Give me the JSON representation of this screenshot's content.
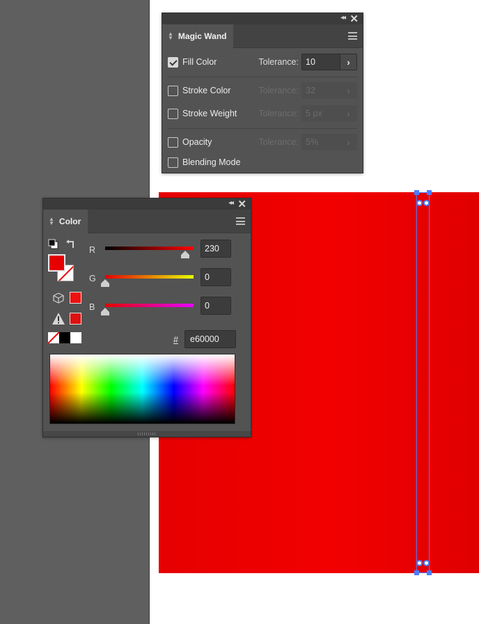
{
  "magic_wand": {
    "title": "Magic Wand",
    "rows": [
      {
        "label": "Fill Color",
        "checked": true,
        "tolerance_label": "Tolerance:",
        "tolerance": "10",
        "enabled": true
      },
      {
        "label": "Stroke Color",
        "checked": false,
        "tolerance_label": "Tolerance:",
        "tolerance": "32",
        "enabled": false
      },
      {
        "label": "Stroke Weight",
        "checked": false,
        "tolerance_label": "Tolerance:",
        "tolerance": "5 px",
        "enabled": false
      },
      {
        "label": "Opacity",
        "checked": false,
        "tolerance_label": "Tolerance:",
        "tolerance": "5%",
        "enabled": false
      },
      {
        "label": "Blending Mode",
        "checked": false
      }
    ]
  },
  "color_panel": {
    "title": "Color",
    "fill_color": "#e60000",
    "r_label": "R",
    "g_label": "G",
    "b_label": "B",
    "r_value": "230",
    "g_value": "0",
    "b_value": "0",
    "r_fraction": 0.902,
    "g_fraction": 0,
    "b_fraction": 0,
    "hex_symbol": "#",
    "hex_value": "e60000",
    "web_safe_color": "#ee1111",
    "gamut_color": "#dd1111"
  },
  "icons": {
    "panel_collapse": "double-left-chevron",
    "panel_close": "close-x",
    "panel_menu": "hamburger-menu",
    "tab_arrows": "up-down-arrows",
    "swap": "swap-arrow",
    "default_colors": "default-fill-stroke",
    "cube": "out-of-web-gamut-cube",
    "warning": "out-of-gamut-warning"
  },
  "canvas": {
    "shape_color": "#e60000",
    "selection_color": "#4a7cff"
  }
}
